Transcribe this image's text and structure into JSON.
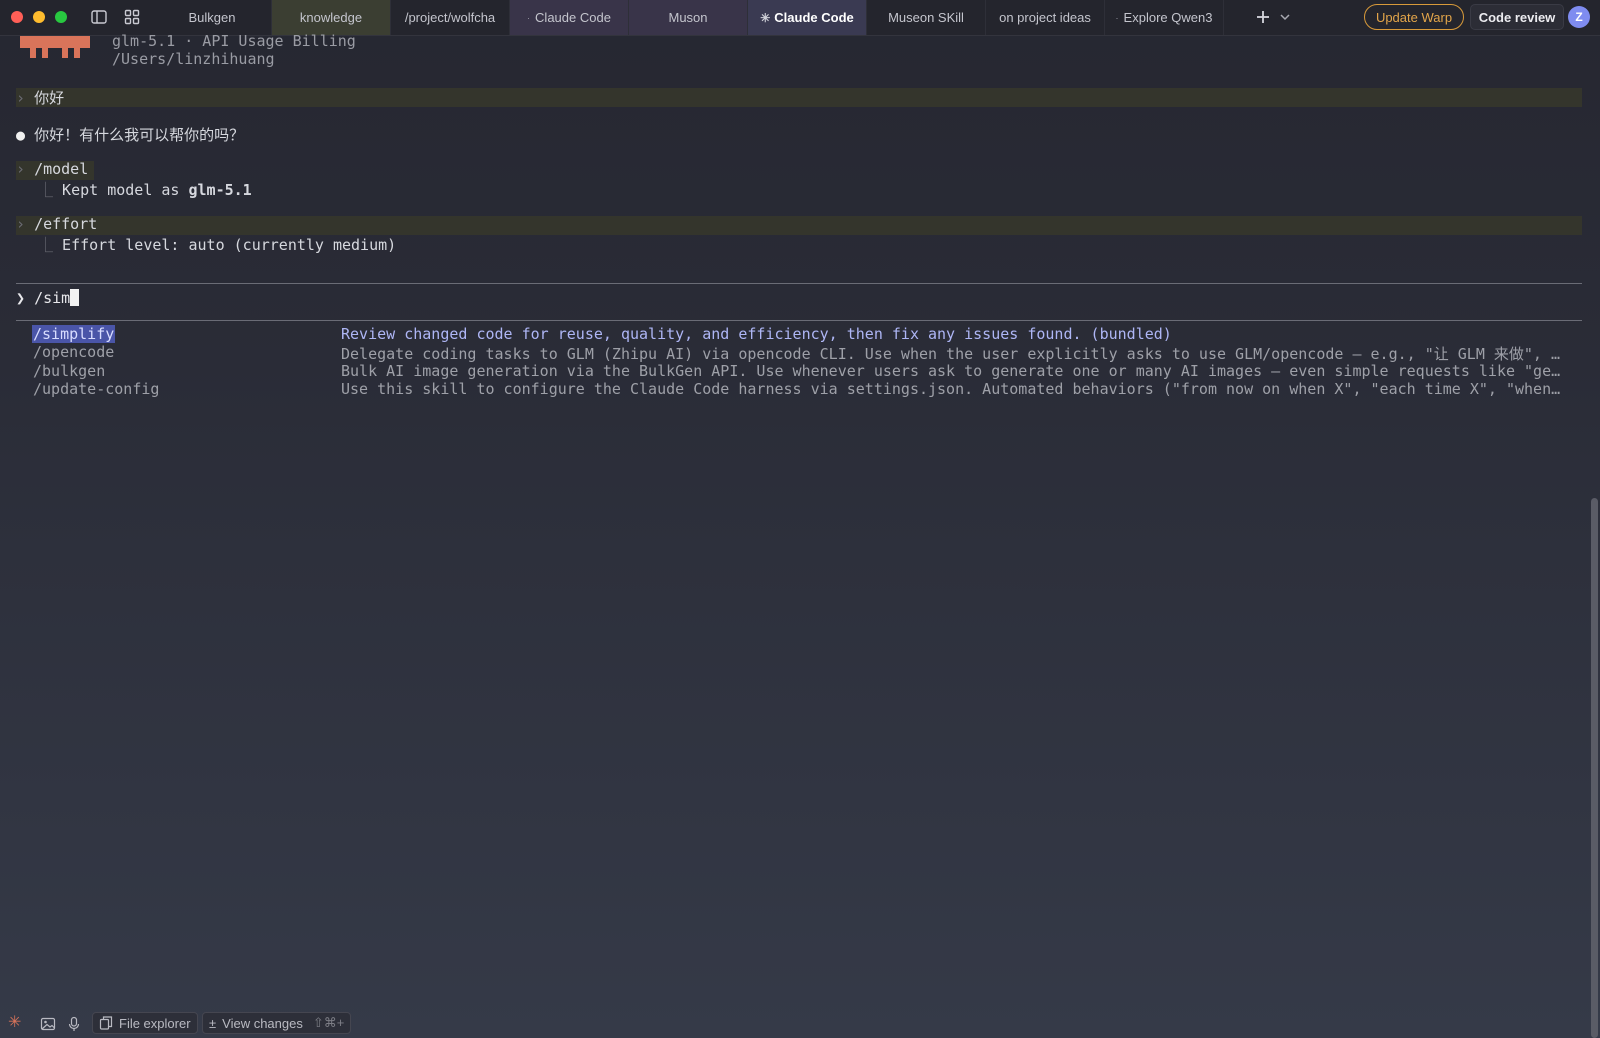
{
  "titlebar": {
    "tabs": [
      {
        "label": "Bulkgen",
        "prefix": ""
      },
      {
        "label": "knowledge",
        "prefix": ""
      },
      {
        "label": "/project/wolfcha",
        "prefix": ""
      },
      {
        "label": "Claude Code",
        "prefix": "·"
      },
      {
        "label": "Muson",
        "prefix": ""
      },
      {
        "label": "Claude Code",
        "prefix": "✳"
      },
      {
        "label": "Museon SKill",
        "prefix": ""
      },
      {
        "label": "on project ideas",
        "prefix": ""
      },
      {
        "label": "Explore Qwen3",
        "prefix": "·"
      }
    ],
    "update_label": "Update Warp",
    "code_review_label": "Code review",
    "avatar_letter": "Z"
  },
  "terminal": {
    "header_line1": "glm-5.1 · API Usage Billing",
    "header_line2": "/Users/linzhihuang",
    "prompt1": "你好",
    "reply1": "你好！有什么我可以帮你的吗？",
    "cmd_model": "/model",
    "model_result_prefix": "Kept model as ",
    "model_result_value": "glm-5.1",
    "cmd_effort": "/effort",
    "effort_result": "Effort level: auto (currently medium)",
    "input_text": "/sim",
    "suggestions": [
      {
        "cmd": "/simplify",
        "desc": "Review changed code for reuse, quality, and efficiency, then fix any issues found. (bundled)"
      },
      {
        "cmd": "/opencode",
        "desc": "Delegate coding tasks to GLM (Zhipu AI) via opencode CLI. Use when the user explicitly asks to use GLM/opencode — e.g., \"让 GLM 来做\", \"用…"
      },
      {
        "cmd": "/bulkgen",
        "desc": "Bulk AI image generation via the BulkGen API. Use whenever users ask to generate one or many AI images — even simple requests like \"genera…"
      },
      {
        "cmd": "/update-config",
        "desc": "Use this skill to configure the Claude Code harness via settings.json. Automated behaviors (\"from now on when X\", \"each time X\", \"whenever…"
      }
    ]
  },
  "bottombar": {
    "file_explorer_label": "File explorer",
    "view_changes_label": "View changes",
    "view_changes_shortcut": "⇧⌘+"
  },
  "colors": {
    "accent": "#e3a54a",
    "selection": "#4a55a8",
    "claude_orange": "#d9745a"
  }
}
